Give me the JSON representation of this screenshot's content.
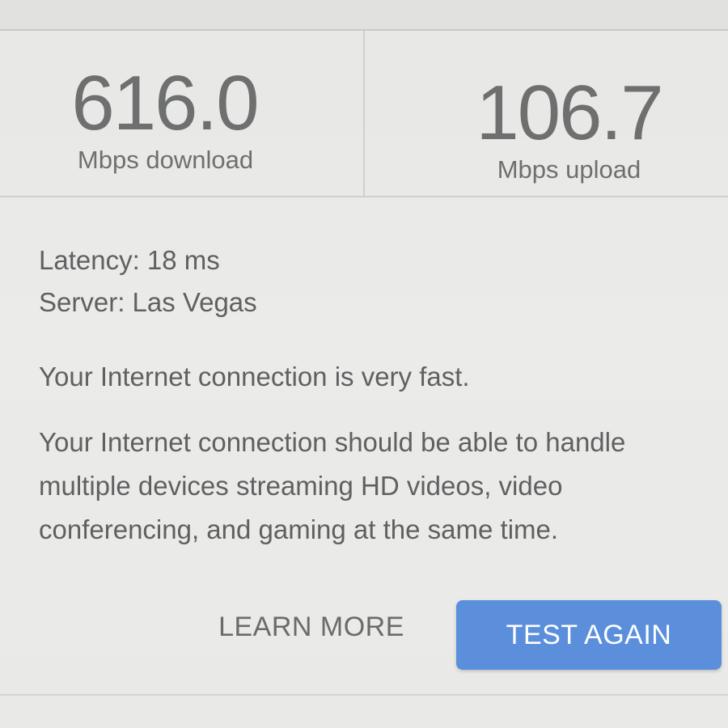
{
  "results": {
    "download": {
      "value": "616.0",
      "unit": "Mbps download"
    },
    "upload": {
      "value": "106.7",
      "unit": "Mbps upload"
    }
  },
  "details": {
    "latency": "Latency: 18 ms",
    "server": "Server: Las Vegas",
    "verdict": "Your Internet connection is very fast.",
    "explanation": "Your Internet connection should be able to handle multiple devices streaming HD videos, video conferencing, and gaming at the same time."
  },
  "actions": {
    "learn_more": "LEARN MORE",
    "test_again": "TEST AGAIN"
  },
  "colors": {
    "accent": "#5b8fdc",
    "text": "#5f6161",
    "background": "#e9e9e7"
  }
}
